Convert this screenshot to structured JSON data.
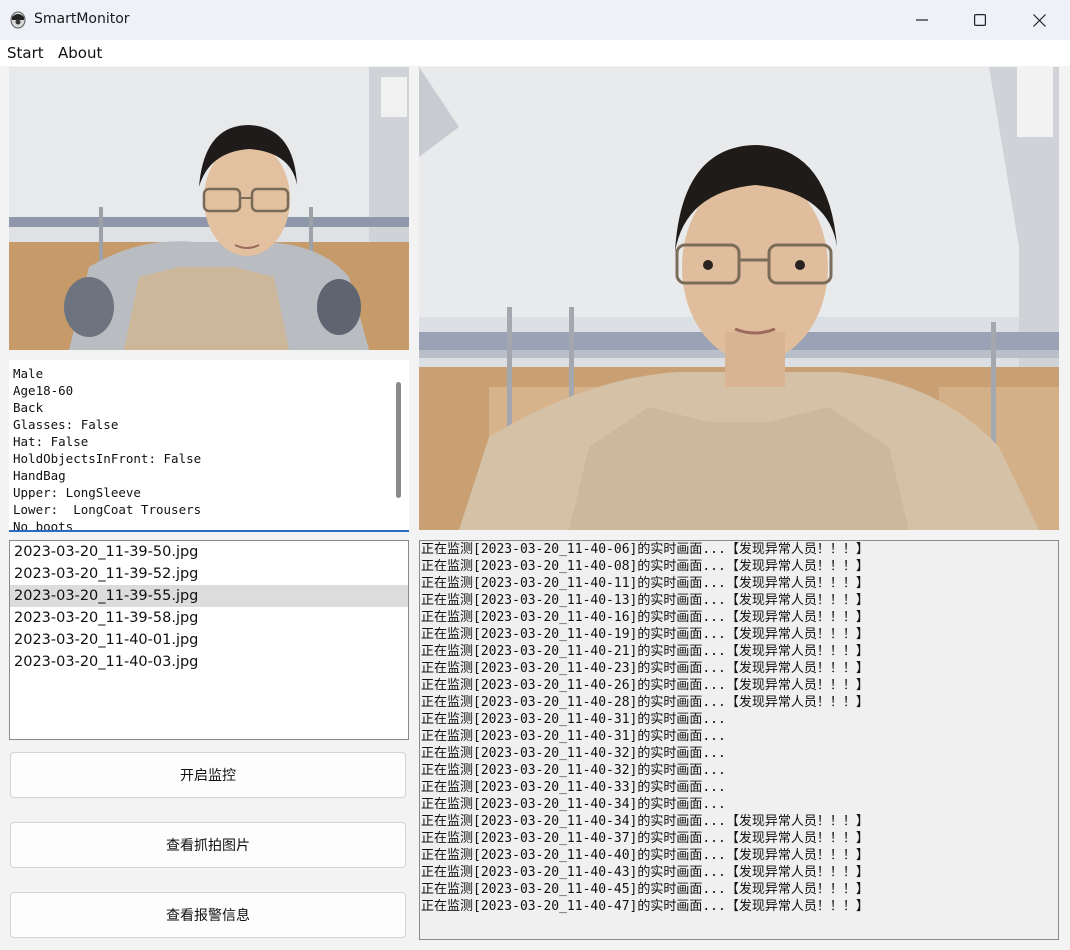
{
  "window": {
    "title": "SmartMonitor",
    "controls": [
      "minimize",
      "maximize",
      "close"
    ]
  },
  "menu": [
    {
      "label": "Start"
    },
    {
      "label": "About"
    }
  ],
  "attributes_text": "Male\nAge18-60\nBack\nGlasses: False\nHat: False\nHoldObjectsInFront: False\nHandBag\nUpper: LongSleeve\nLower:  LongCoat Trousers\nNo boots",
  "files": [
    {
      "name": "2023-03-20_11-39-50.jpg",
      "selected": false
    },
    {
      "name": "2023-03-20_11-39-52.jpg",
      "selected": false
    },
    {
      "name": "2023-03-20_11-39-55.jpg",
      "selected": true
    },
    {
      "name": "2023-03-20_11-39-58.jpg",
      "selected": false
    },
    {
      "name": "2023-03-20_11-40-01.jpg",
      "selected": false
    },
    {
      "name": "2023-03-20_11-40-03.jpg",
      "selected": false
    }
  ],
  "buttons": {
    "start_monitor": "开启监控",
    "view_captures": "查看抓拍图片",
    "view_alarms": "查看报警信息"
  },
  "log": [
    "正在监测[2023-03-20_11-40-06]的实时画面...【发现异常人员！！！】",
    "正在监测[2023-03-20_11-40-08]的实时画面...【发现异常人员！！！】",
    "正在监测[2023-03-20_11-40-11]的实时画面...【发现异常人员！！！】",
    "正在监测[2023-03-20_11-40-13]的实时画面...【发现异常人员！！！】",
    "正在监测[2023-03-20_11-40-16]的实时画面...【发现异常人员！！！】",
    "正在监测[2023-03-20_11-40-19]的实时画面...【发现异常人员！！！】",
    "正在监测[2023-03-20_11-40-21]的实时画面...【发现异常人员！！！】",
    "正在监测[2023-03-20_11-40-23]的实时画面...【发现异常人员！！！】",
    "正在监测[2023-03-20_11-40-26]的实时画面...【发现异常人员！！！】",
    "正在监测[2023-03-20_11-40-28]的实时画面...【发现异常人员！！！】",
    "正在监测[2023-03-20_11-40-31]的实时画面...",
    "正在监测[2023-03-20_11-40-31]的实时画面...",
    "正在监测[2023-03-20_11-40-32]的实时画面...",
    "正在监测[2023-03-20_11-40-32]的实时画面...",
    "正在监测[2023-03-20_11-40-33]的实时画面...",
    "正在监测[2023-03-20_11-40-34]的实时画面...",
    "正在监测[2023-03-20_11-40-34]的实时画面...【发现异常人员！！！】",
    "正在监测[2023-03-20_11-40-37]的实时画面...【发现异常人员！！！】",
    "正在监测[2023-03-20_11-40-40]的实时画面...【发现异常人员！！！】",
    "正在监测[2023-03-20_11-40-43]的实时画面...【发现异常人员！！！】",
    "正在监测[2023-03-20_11-40-45]的实时画面...【发现异常人员！！！】",
    "正在监测[2023-03-20_11-40-47]的实时画面...【发现异常人员！！！】"
  ]
}
